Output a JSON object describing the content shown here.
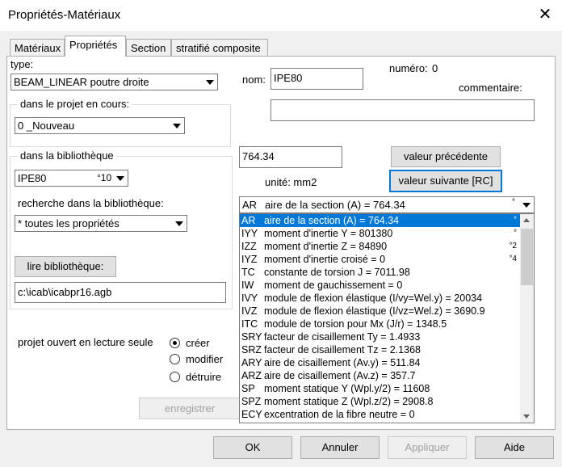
{
  "window": {
    "title": "Propriétés-Matériaux",
    "close_glyph": "✕"
  },
  "tabs": [
    {
      "label": "Matériaux",
      "active": false
    },
    {
      "label": "Propriétés",
      "active": true
    },
    {
      "label": "Section",
      "active": false
    },
    {
      "label": "stratifié composite",
      "active": false
    }
  ],
  "type": {
    "label": "type:",
    "value": "BEAM_LINEAR poutre droite"
  },
  "projet": {
    "group_title": "dans le projet en cours:",
    "value": "0 _Nouveau"
  },
  "bibliotheque": {
    "group_title": "dans la bibliothèque",
    "combo_value": "IPE80",
    "combo_suffix": "°10",
    "search_label": "recherche dans la bibliothèque:",
    "search_value": "* toutes les propriétés",
    "read_button": "lire bibliothèque:",
    "path_value": "c:\\icab\\icabpr16.agb"
  },
  "readonly": {
    "label": "projet ouvert en lecture seule",
    "options": [
      {
        "label": "créer",
        "checked": true
      },
      {
        "label": "modifier",
        "checked": false
      },
      {
        "label": "détruire",
        "checked": false
      }
    ]
  },
  "right": {
    "nom_label": "nom:",
    "nom_value": "IPE80",
    "numero_label": "numéro:",
    "numero_value": "0",
    "comment_label": "commentaire:",
    "comment_value": "",
    "value_field": "764.34",
    "unit_text": "unité: mm2",
    "prev_button": "valeur précédente",
    "next_button": "valeur suivante [RC]",
    "prop_combo_code": "AR",
    "prop_combo_text": "aire de la section (A) = 764.34",
    "prop_combo_unit": "°"
  },
  "property_list": [
    {
      "code": "AR",
      "text": "aire de la section (A) = 764.34",
      "unit": "°",
      "selected": true
    },
    {
      "code": "IYY",
      "text": "moment d'inertie Y = 801380",
      "unit": "°",
      "selected": false
    },
    {
      "code": "IZZ",
      "text": "moment d'inertie Z = 84890",
      "unit": "°2",
      "selected": false
    },
    {
      "code": "IYZ",
      "text": "moment d'inertie croisé = 0",
      "unit": "°4",
      "selected": false
    },
    {
      "code": "TC",
      "text": "constante de torsion J = 7011.98",
      "unit": "",
      "selected": false
    },
    {
      "code": "IW",
      "text": "moment de gauchissement = 0",
      "unit": "",
      "selected": false
    },
    {
      "code": "IVY",
      "text": "module de flexion élastique (I/vy=Wel.y) = 20034",
      "unit": "",
      "selected": false
    },
    {
      "code": "IVZ",
      "text": "module de flexion élastique (I/vz=Wel.z) = 3690.9",
      "unit": "",
      "selected": false
    },
    {
      "code": "ITC",
      "text": "module de torsion pour Mx (J/r) = 1348.5",
      "unit": "",
      "selected": false
    },
    {
      "code": "SRY",
      "text": "facteur de cisaillement Ty = 1.4933",
      "unit": "",
      "selected": false
    },
    {
      "code": "SRZ",
      "text": "facteur de cisaillement Tz = 2.1368",
      "unit": "",
      "selected": false
    },
    {
      "code": "ARY",
      "text": "aire de cisaillement (Av.y) = 511.84",
      "unit": "",
      "selected": false
    },
    {
      "code": "ARZ",
      "text": "aire de cisaillement (Av.z) = 357.7",
      "unit": "",
      "selected": false
    },
    {
      "code": "SP",
      "text": "moment statique Y (Wpl.y/2) = 11608",
      "unit": "",
      "selected": false
    },
    {
      "code": "SPZ",
      "text": "moment statique Z (Wpl.z/2) = 2908.8",
      "unit": "",
      "selected": false
    },
    {
      "code": "ECY",
      "text": "excentration de la fibre neutre = 0",
      "unit": "",
      "selected": false
    }
  ],
  "footer": {
    "save": "enregistrer",
    "ok": "OK",
    "cancel": "Annuler",
    "apply": "Appliquer",
    "help": "Aide"
  },
  "colors": {
    "selection": "#0078d7",
    "window_bg": "#f0f0f0"
  }
}
